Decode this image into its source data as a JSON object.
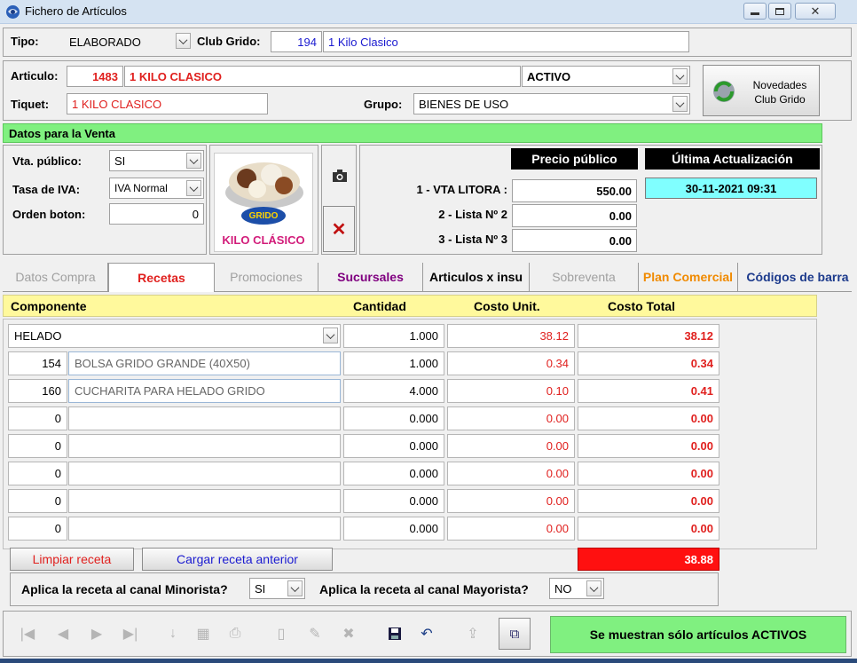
{
  "window": {
    "title": "Fichero de Artículos"
  },
  "header": {
    "tipo_label": "Tipo:",
    "tipo_value": "ELABORADO",
    "club_label": "Club Grido:",
    "club_code": "194",
    "club_name": "1 Kilo Clasico"
  },
  "article": {
    "articulo_label": "Articulo:",
    "articulo_code": "1483",
    "articulo_name": "1 KILO CLASICO",
    "estado": "ACTIVO",
    "tiquet_label": "Tiquet:",
    "tiquet_value": "1 KILO CLASICO",
    "grupo_label": "Grupo:",
    "grupo_value": "BIENES DE USO",
    "novedades_line1": "Novedades",
    "novedades_line2": "Club Grido"
  },
  "venta": {
    "section_title": "Datos para la Venta",
    "vta_publico_label": "Vta. público:",
    "vta_publico_value": "SI",
    "iva_label": "Tasa de IVA:",
    "iva_value": "IVA Normal",
    "orden_label": "Orden boton:",
    "orden_value": "0",
    "image_brand": "GRIDO",
    "image_caption": "KILO CLÁSICO",
    "precio_header": "Precio público",
    "actualizacion_header": "Última Actualización",
    "actualizacion_value": "30-11-2021 09:31",
    "prices": [
      {
        "label": "1 - VTA LITORA :",
        "value": "550.00"
      },
      {
        "label": "2 - Lista Nº 2",
        "value": "0.00"
      },
      {
        "label": "3 - Lista Nº 3",
        "value": "0.00"
      }
    ]
  },
  "tabs": [
    {
      "label": "Datos Compra",
      "color": "#a0a0a0"
    },
    {
      "label": "Recetas",
      "color": "#e0201e"
    },
    {
      "label": "Promociones",
      "color": "#a0a0a0"
    },
    {
      "label": "Sucursales",
      "color": "#800080"
    },
    {
      "label": "Articulos x insu",
      "color": "#000000"
    },
    {
      "label": "Sobreventa",
      "color": "#a0a0a0"
    },
    {
      "label": "Plan Comercial",
      "color": "#f08a00"
    },
    {
      "label": "Códigos de barra",
      "color": "#1c3a8c"
    }
  ],
  "recipe": {
    "col_componente": "Componente",
    "col_cantidad": "Cantidad",
    "col_costo_unit": "Costo Unit.",
    "col_costo_total": "Costo Total",
    "first_row": {
      "name": "HELADO",
      "cantidad": "1.000",
      "costo_unit": "38.12",
      "costo_total": "38.12"
    },
    "rows": [
      {
        "code": "154",
        "name": "BOLSA GRIDO GRANDE (40X50)",
        "cantidad": "1.000",
        "costo_unit": "0.34",
        "costo_total": "0.34"
      },
      {
        "code": "160",
        "name": "CUCHARITA PARA HELADO GRIDO",
        "cantidad": "4.000",
        "costo_unit": "0.10",
        "costo_total": "0.41"
      },
      {
        "code": "0",
        "name": "",
        "cantidad": "0.000",
        "costo_unit": "0.00",
        "costo_total": "0.00"
      },
      {
        "code": "0",
        "name": "",
        "cantidad": "0.000",
        "costo_unit": "0.00",
        "costo_total": "0.00"
      },
      {
        "code": "0",
        "name": "",
        "cantidad": "0.000",
        "costo_unit": "0.00",
        "costo_total": "0.00"
      },
      {
        "code": "0",
        "name": "",
        "cantidad": "0.000",
        "costo_unit": "0.00",
        "costo_total": "0.00"
      },
      {
        "code": "0",
        "name": "",
        "cantidad": "0.000",
        "costo_unit": "0.00",
        "costo_total": "0.00"
      }
    ],
    "limpiar_label": "Limpiar receta",
    "cargar_label": "Cargar receta anterior",
    "total": "38.88",
    "minorista_label": "Aplica la receta al canal Minorista?",
    "minorista_value": "SI",
    "mayorista_label": "Aplica la receta al canal Mayorista?",
    "mayorista_value": "NO"
  },
  "status": {
    "activos_label": "Se muestran sólo artículos ACTIVOS"
  },
  "colors": {
    "green_bar": "#80f080",
    "red_text": "#e0201e",
    "blue_text": "#1a1ad0",
    "cyan": "#80ffff",
    "total_red": "#ff1010"
  }
}
